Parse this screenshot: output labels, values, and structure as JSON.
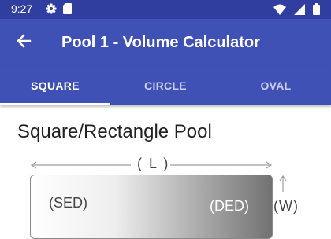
{
  "status_bar": {
    "time": "9:27",
    "left_icons": [
      "gear-icon",
      "sd-card-icon"
    ],
    "right_icons": [
      "wifi-icon",
      "signal-icon",
      "battery-icon"
    ],
    "background": "#303f9f"
  },
  "app_bar": {
    "title": "Pool 1 - Volume Calculator",
    "back_icon": "arrow-back-icon",
    "background": "#3f51b5"
  },
  "tabs": [
    {
      "label": "SQUARE",
      "selected": true
    },
    {
      "label": "CIRCLE",
      "selected": false
    },
    {
      "label": "OVAL",
      "selected": false
    }
  ],
  "main": {
    "section_title": "Square/Rectangle Pool",
    "diagram": {
      "length_label": "( L )",
      "width_label": "(W)",
      "shallow_end_label": "(SED)",
      "deep_end_label": "(DED)"
    }
  }
}
